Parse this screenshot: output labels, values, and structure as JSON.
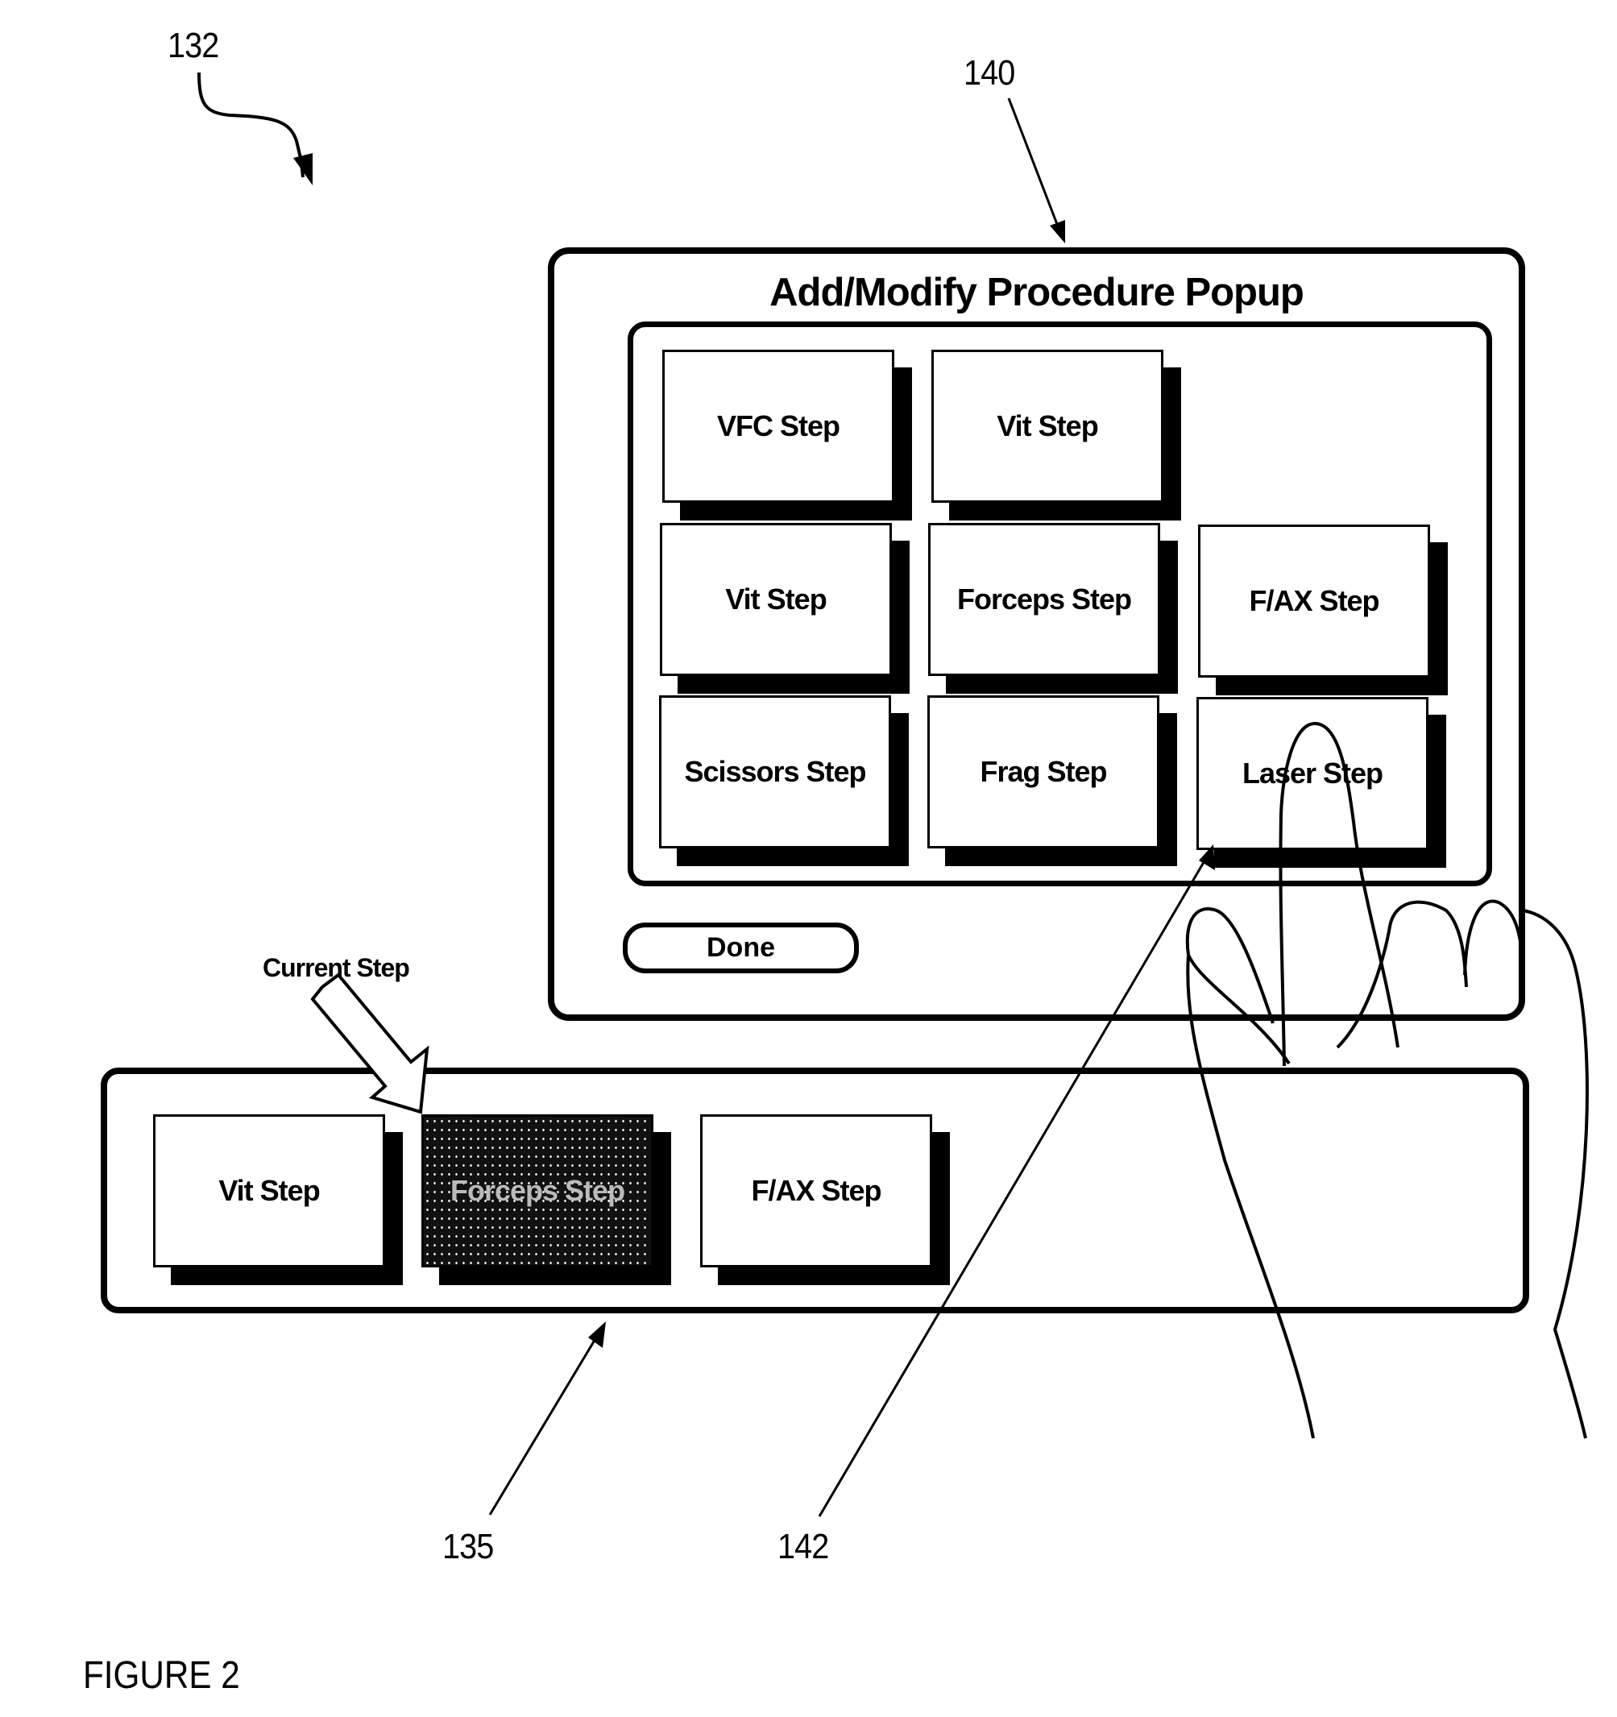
{
  "figure": {
    "label": "FIGURE 2",
    "reference_numerals": {
      "system": "132",
      "popup": "140",
      "step_strip": "135",
      "touch_selection": "142"
    }
  },
  "popup": {
    "title": "Add/Modify Procedure Popup",
    "step_buttons": [
      {
        "label": "VFC Step",
        "row": 1,
        "col": 1
      },
      {
        "label": "Vit Step",
        "row": 1,
        "col": 2
      },
      {
        "label": "Vit Step",
        "row": 2,
        "col": 1
      },
      {
        "label": "Forceps Step",
        "row": 2,
        "col": 2
      },
      {
        "label": "F/AX Step",
        "row": 2,
        "col": 3
      },
      {
        "label": "Scissors Step",
        "row": 3,
        "col": 1
      },
      {
        "label": "Frag Step",
        "row": 3,
        "col": 2
      },
      {
        "label": "Laser Step",
        "row": 3,
        "col": 3
      }
    ],
    "done_label": "Done"
  },
  "procedure_strip": {
    "current_step_label": "Current Step",
    "steps": [
      {
        "label": "Vit Step",
        "current": false
      },
      {
        "label": "Forceps Step",
        "current": true
      },
      {
        "label": "F/AX Step",
        "current": false
      }
    ]
  },
  "colors": {
    "ink": "#000000",
    "background": "#ffffff"
  }
}
